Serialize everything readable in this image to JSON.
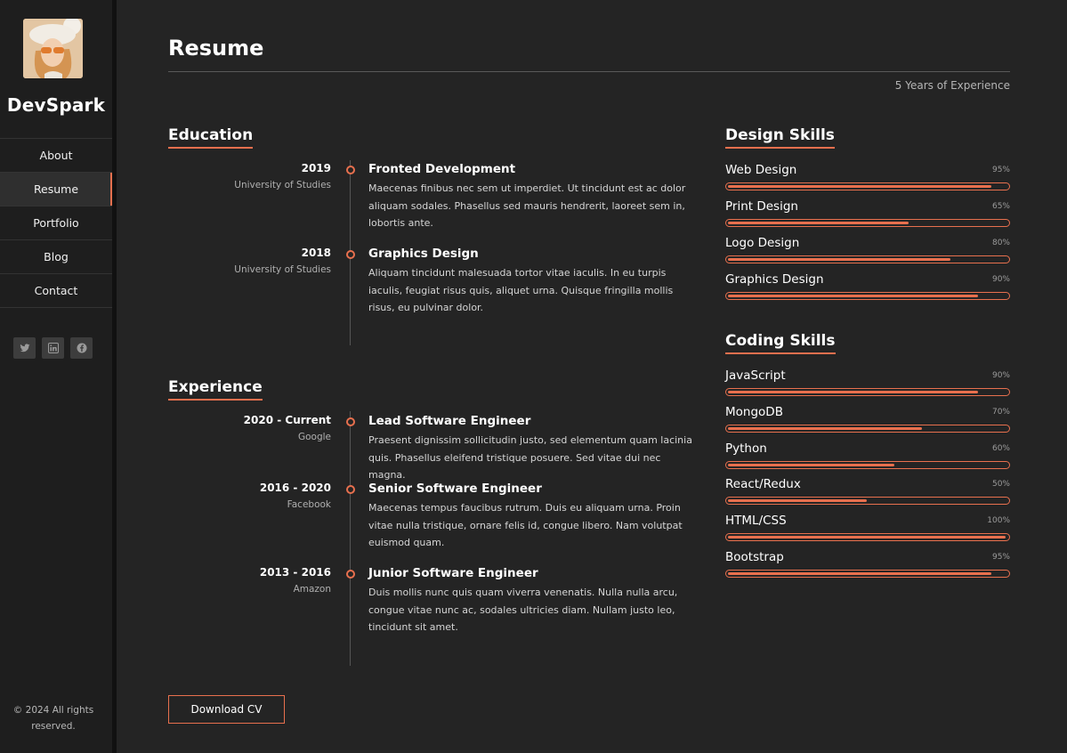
{
  "sidebar": {
    "brand": "DevSpark",
    "nav": [
      "About",
      "Resume",
      "Portfolio",
      "Blog",
      "Contact"
    ],
    "active_nav": "Resume",
    "socials": [
      "twitter-icon",
      "linkedin-icon",
      "facebook-icon"
    ],
    "copyright": "© 2024 All rights reserved."
  },
  "main": {
    "title": "Resume",
    "experience_years": "5 Years of Experience",
    "education": {
      "heading": "Education",
      "items": [
        {
          "date": "2019",
          "org": "University of Studies",
          "role": "Fronted Development",
          "desc": "Maecenas finibus nec sem ut imperdiet. Ut tincidunt est ac dolor aliquam sodales. Phasellus sed mauris hendrerit, laoreet sem in, lobortis ante."
        },
        {
          "date": "2018",
          "org": "University of Studies",
          "role": "Graphics Design",
          "desc": "Aliquam tincidunt malesuada tortor vitae iaculis. In eu turpis iaculis, feugiat risus quis, aliquet urna. Quisque fringilla mollis risus, eu pulvinar dolor."
        }
      ]
    },
    "experience": {
      "heading": "Experience",
      "items": [
        {
          "date": "2020 - Current",
          "org": "Google",
          "role": "Lead Software Engineer",
          "desc": "Praesent dignissim sollicitudin justo, sed elementum quam lacinia quis. Phasellus eleifend tristique posuere. Sed vitae dui nec magna."
        },
        {
          "date": "2016 - 2020",
          "org": "Facebook",
          "role": "Senior Software Engineer",
          "desc": "Maecenas tempus faucibus rutrum. Duis eu aliquam urna. Proin vitae nulla tristique, ornare felis id, congue libero. Nam volutpat euismod quam."
        },
        {
          "date": "2013 - 2016",
          "org": "Amazon",
          "role": "Junior Software Engineer",
          "desc": "Duis mollis nunc quis quam viverra venenatis. Nulla nulla arcu, congue vitae nunc ac, sodales ultricies diam. Nullam justo leo, tincidunt sit amet."
        }
      ]
    },
    "design_skills": {
      "heading": "Design Skills",
      "items": [
        {
          "name": "Web Design",
          "pct_label": "95%",
          "level": 95
        },
        {
          "name": "Print Design",
          "pct_label": "65%",
          "level": 65
        },
        {
          "name": "Logo Design",
          "pct_label": "80%",
          "level": 80
        },
        {
          "name": "Graphics Design",
          "pct_label": "90%",
          "level": 90
        }
      ]
    },
    "coding_skills": {
      "heading": "Coding Skills",
      "items": [
        {
          "name": "JavaScript",
          "pct_label": "90%",
          "level": 90
        },
        {
          "name": "MongoDB",
          "pct_label": "70%",
          "level": 70
        },
        {
          "name": "Python",
          "pct_label": "60%",
          "level": 60
        },
        {
          "name": "React/Redux",
          "pct_label": "50%",
          "level": 50
        },
        {
          "name": "HTML/CSS",
          "pct_label": "100%",
          "level": 100
        },
        {
          "name": "Bootstrap",
          "pct_label": "95%",
          "level": 95
        }
      ]
    },
    "download_label": "Download CV"
  },
  "colors": {
    "accent": "#e8704e",
    "background": "#242424",
    "sidebar": "#1e1e1e"
  }
}
